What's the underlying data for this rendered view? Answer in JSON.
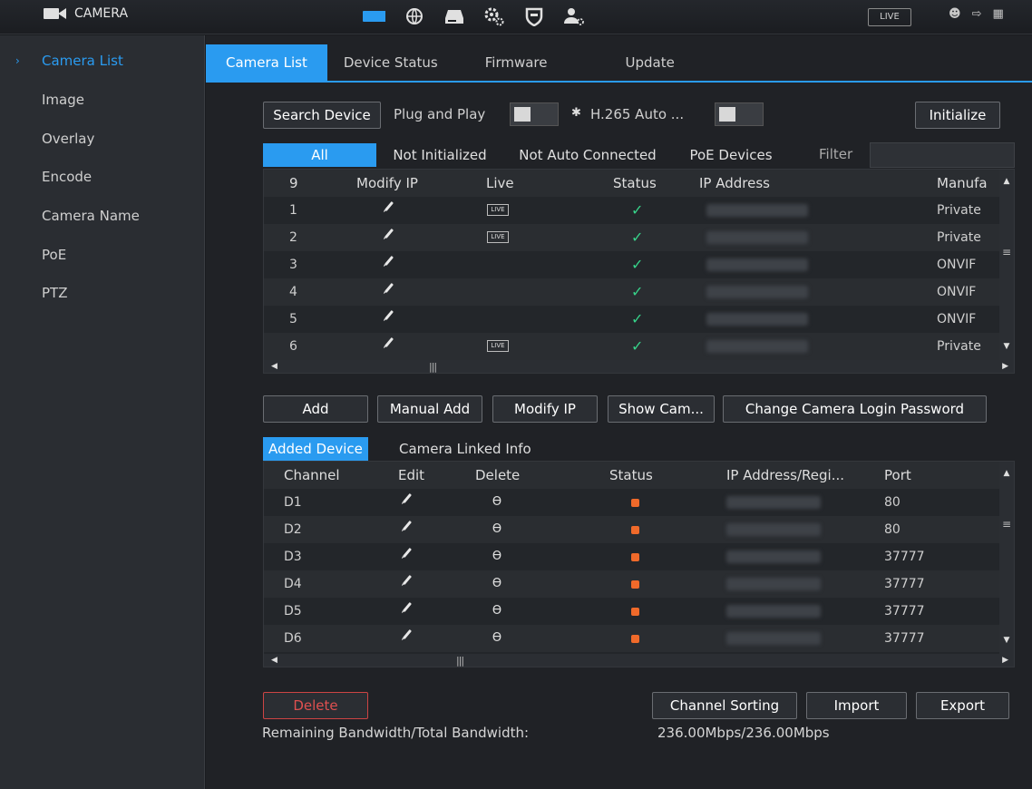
{
  "app": {
    "title": "CAMERA",
    "live_label": "LIVE"
  },
  "top_icons": [
    "camera-icon",
    "network-icon",
    "storage-icon",
    "system-icon",
    "security-icon",
    "account-icon"
  ],
  "sidebar": {
    "items": [
      {
        "label": "Camera List",
        "active": true
      },
      {
        "label": "Image"
      },
      {
        "label": "Overlay"
      },
      {
        "label": "Encode"
      },
      {
        "label": "Camera Name"
      },
      {
        "label": "PoE"
      },
      {
        "label": "PTZ"
      }
    ]
  },
  "tabs": [
    {
      "label": "Camera List",
      "active": true
    },
    {
      "label": "Device Status"
    },
    {
      "label": "Firmware"
    },
    {
      "label": "Update"
    }
  ],
  "toolbar": {
    "search_device": "Search Device",
    "plug_and_play": "Plug and Play",
    "h265_auto": "H.265 Auto ...",
    "initialize": "Initialize"
  },
  "filters": {
    "all": "All",
    "not_initialized": "Not Initialized",
    "not_auto_connected": "Not Auto Connected",
    "poe_devices": "PoE Devices",
    "filter_label": "Filter",
    "filter_value": ""
  },
  "search_table": {
    "columns": [
      "9",
      "Modify IP",
      "Live",
      "Status",
      "IP Address",
      "Manufa"
    ],
    "rows": [
      {
        "no": "1",
        "live": true,
        "status": "ok",
        "manufacturer": "Private"
      },
      {
        "no": "2",
        "live": true,
        "status": "ok",
        "manufacturer": "Private"
      },
      {
        "no": "3",
        "live": false,
        "status": "ok",
        "manufacturer": "ONVIF"
      },
      {
        "no": "4",
        "live": false,
        "status": "ok",
        "manufacturer": "ONVIF"
      },
      {
        "no": "5",
        "live": false,
        "status": "ok",
        "manufacturer": "ONVIF"
      },
      {
        "no": "6",
        "live": true,
        "status": "ok",
        "manufacturer": "Private"
      }
    ]
  },
  "actions": {
    "add": "Add",
    "manual_add": "Manual Add",
    "modify_ip": "Modify IP",
    "show_cam": "Show Cam...",
    "change_password": "Change Camera Login Password"
  },
  "added_tabs": {
    "added_device": "Added Device",
    "camera_linked_info": "Camera Linked Info"
  },
  "added_table": {
    "columns": [
      "Channel",
      "Edit",
      "Delete",
      "Status",
      "IP Address/Regi...",
      "Port"
    ],
    "rows": [
      {
        "channel": "D1",
        "port": "80"
      },
      {
        "channel": "D2",
        "port": "80"
      },
      {
        "channel": "D3",
        "port": "37777"
      },
      {
        "channel": "D4",
        "port": "37777"
      },
      {
        "channel": "D5",
        "port": "37777"
      },
      {
        "channel": "D6",
        "port": "37777"
      }
    ]
  },
  "bottom": {
    "delete": "Delete",
    "channel_sorting": "Channel Sorting",
    "import": "Import",
    "export": "Export",
    "bandwidth_label": "Remaining Bandwidth/Total Bandwidth:",
    "bandwidth_value": "236.00Mbps/236.00Mbps"
  },
  "colors": {
    "accent": "#2a9bf0",
    "ok": "#37d38a",
    "offline": "#f06a2a",
    "danger": "#e05050"
  }
}
